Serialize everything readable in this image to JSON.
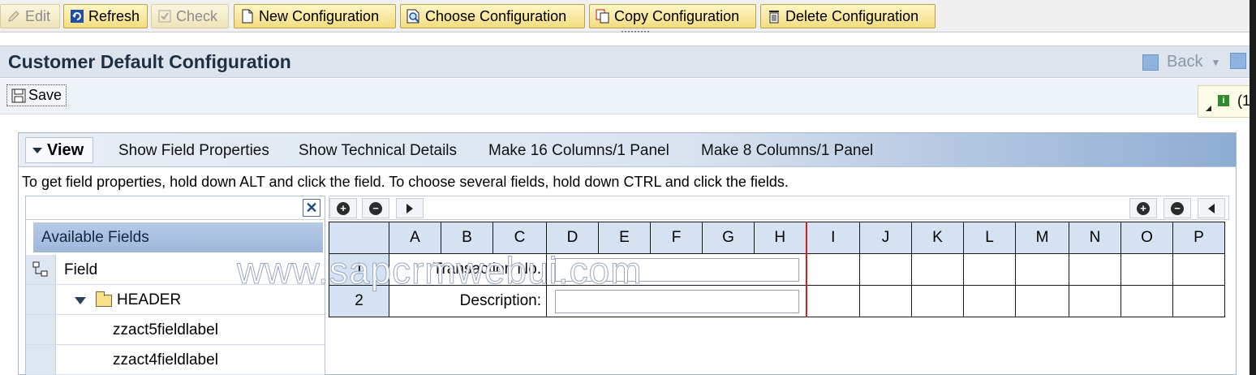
{
  "toolbar": {
    "buttons": [
      {
        "label": "Edit",
        "icon": "pencil-icon",
        "enabled": false
      },
      {
        "label": "Refresh",
        "icon": "refresh-icon",
        "enabled": true
      },
      {
        "label": "Check",
        "icon": "check-icon",
        "enabled": false
      },
      {
        "label": "New Configuration",
        "icon": "new-document-icon",
        "enabled": true
      },
      {
        "label": "Choose Configuration",
        "icon": "search-document-icon",
        "enabled": true
      },
      {
        "label": "Copy Configuration",
        "icon": "copy-icon",
        "enabled": true
      },
      {
        "label": "Delete Configuration",
        "icon": "trash-icon",
        "enabled": true
      }
    ]
  },
  "header": {
    "title": "Customer Default Configuration",
    "back_label": "Back"
  },
  "savebar": {
    "save_label": "Save",
    "message_indicator": "(1"
  },
  "viewbar": {
    "view_label": "View",
    "links": [
      "Show Field Properties",
      "Show Technical Details",
      "Make 16 Columns/1 Panel",
      "Make 8 Columns/1 Panel"
    ]
  },
  "hint": "To get field properties, hold down ALT and click the field. To choose several fields, hold down CTRL and click the fields.",
  "tree": {
    "title": "Available Fields",
    "column_label": "Field",
    "rows": [
      {
        "label": "HEADER",
        "type": "folder"
      },
      {
        "label": "zzact5fieldlabel",
        "type": "field"
      },
      {
        "label": "zzact4fieldlabel",
        "type": "field"
      }
    ]
  },
  "grid": {
    "columns": [
      "A",
      "B",
      "C",
      "D",
      "E",
      "F",
      "G",
      "H",
      "I",
      "J",
      "K",
      "L",
      "M",
      "N",
      "O",
      "P"
    ],
    "rows": [
      {
        "number": "1",
        "label": "Transaction No."
      },
      {
        "number": "2",
        "label": "Description:"
      }
    ]
  },
  "watermark": "www.sapcrmwebui.com",
  "colors": {
    "toolbar_button": "#f3dc80",
    "title_bar": "#dde4ee",
    "grid_header": "#d4e2f4",
    "panel_divider": "#e01818"
  }
}
